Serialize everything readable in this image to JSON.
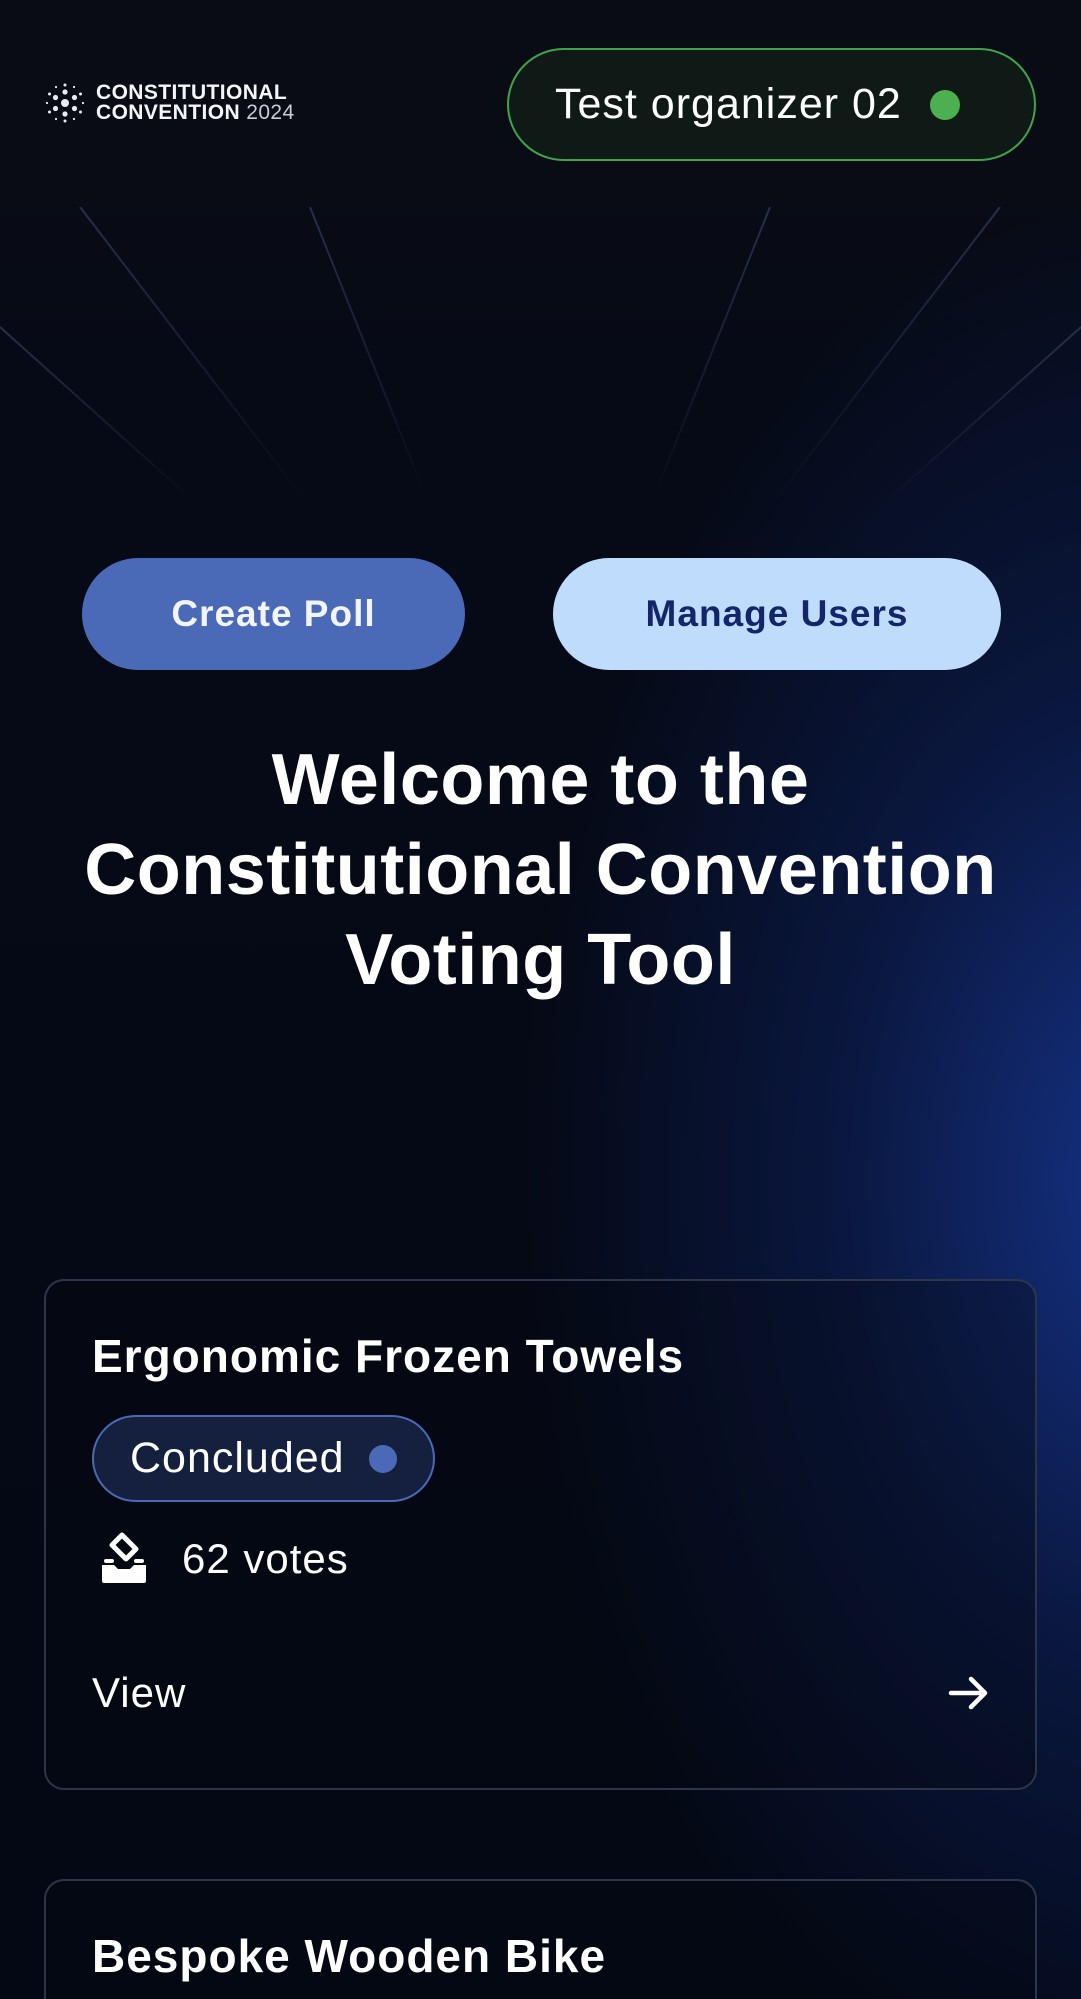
{
  "header": {
    "logo": {
      "line1": "CONSTITUTIONAL",
      "line2": "CONVENTION",
      "year": "2024",
      "icon": "cardano-logo-icon"
    },
    "user": {
      "name": "Test organizer 02",
      "status_color": "#4caf50"
    }
  },
  "actions": {
    "create_poll_label": "Create Poll",
    "manage_users_label": "Manage Users"
  },
  "hero": {
    "title": "Welcome to the Constitutional Convention Voting Tool"
  },
  "polls": [
    {
      "title": "Ergonomic Frozen Towels",
      "status": "Concluded",
      "status_color": "#4a6ab8",
      "votes": "62 votes",
      "vote_icon": "ballot-box-icon",
      "link_label": "View",
      "link_icon": "arrow-right-icon"
    },
    {
      "title": "Bespoke Wooden Bike"
    }
  ],
  "colors": {
    "accent_blue": "#4a6ab8",
    "light_blue": "#bfdcfd",
    "online_green": "#4caf50"
  }
}
